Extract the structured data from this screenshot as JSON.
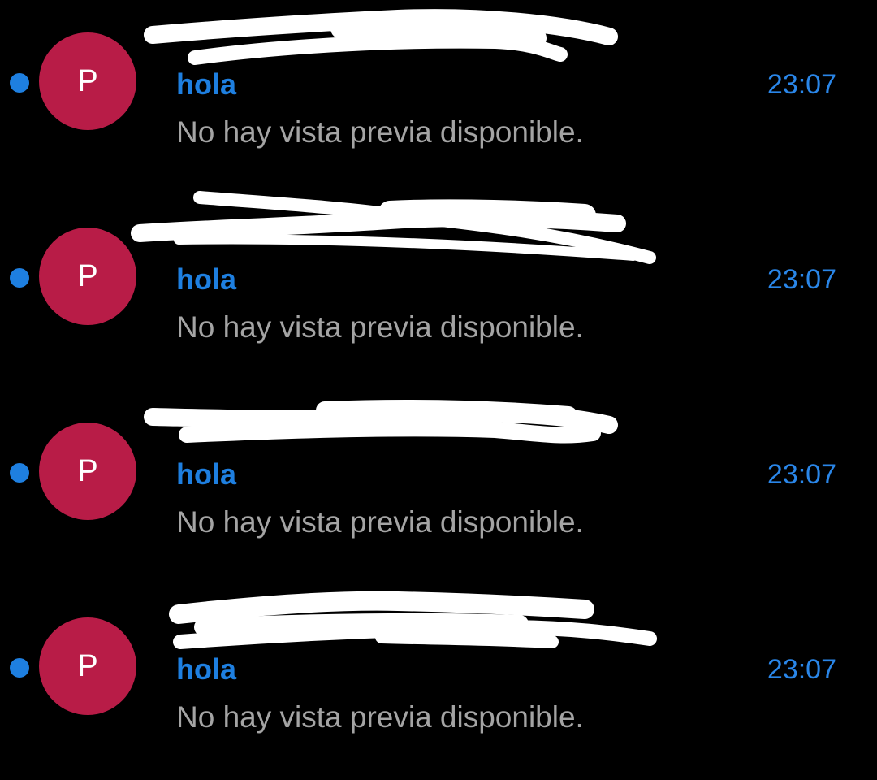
{
  "colors": {
    "background": "#000000",
    "accent_blue": "#1e7fe0",
    "time_blue": "#2a86e8",
    "avatar_red": "#b81c47",
    "preview_gray": "#a4a4a4",
    "redaction_white": "#ffffff"
  },
  "messages": [
    {
      "avatar_letter": "P",
      "subject": "hola",
      "time": "23:07",
      "preview": "No hay vista previa disponible.",
      "unread": true
    },
    {
      "avatar_letter": "P",
      "subject": "hola",
      "time": "23:07",
      "preview": "No hay vista previa disponible.",
      "unread": true
    },
    {
      "avatar_letter": "P",
      "subject": "hola",
      "time": "23:07",
      "preview": "No hay vista previa disponible.",
      "unread": true
    },
    {
      "avatar_letter": "P",
      "subject": "hola",
      "time": "23:07",
      "preview": "No hay vista previa disponible.",
      "unread": true
    }
  ]
}
